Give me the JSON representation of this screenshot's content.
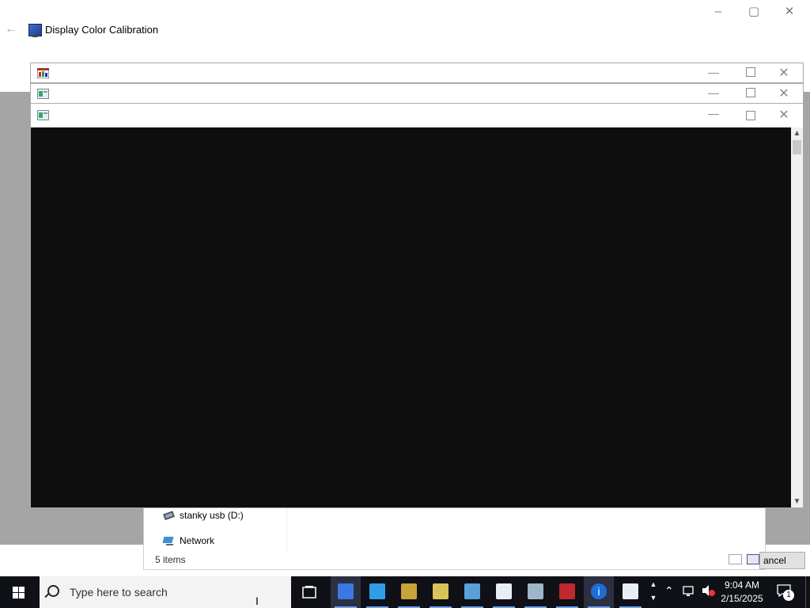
{
  "dcc": {
    "title": "Display Color Calibration",
    "back_icon": "back-arrow-icon",
    "controls": {
      "minimize": "–",
      "maximize": "▢",
      "close": "✕"
    }
  },
  "stack_windows": [
    {
      "icon": "image-app-icon"
    },
    {
      "icon": "window-app-icon"
    },
    {
      "icon": "window-app-icon"
    }
  ],
  "explorer": {
    "items": [
      {
        "label": "stanky usb (D:)",
        "icon": "usb-drive-icon"
      },
      {
        "label": "Network",
        "icon": "network-icon"
      }
    ],
    "status": "5 items"
  },
  "cancel_button": "ancel",
  "taskbar": {
    "search_placeholder": "Type here to search",
    "clock_time": "9:04 AM",
    "clock_date": "2/15/2025",
    "notification_count": "1",
    "apps": [
      {
        "name": "display-calibration-app",
        "color": "#3b78e7",
        "active": true
      },
      {
        "name": "windows-update-app",
        "color": "#2f9ee8",
        "active": false
      },
      {
        "name": "paint-app",
        "color": "#c8a23a",
        "active": false
      },
      {
        "name": "pencil-app",
        "color": "#d7c35a",
        "active": false
      },
      {
        "name": "window-app",
        "color": "#5aa0d8",
        "active": false
      },
      {
        "name": "notepad-app",
        "color": "#e8eef5",
        "active": false
      },
      {
        "name": "printer-app",
        "color": "#9fb6c8",
        "active": false
      },
      {
        "name": "toolbox-app",
        "color": "#c0282d",
        "active": false
      },
      {
        "name": "info-app",
        "color": "#1c6fd6",
        "active": true
      },
      {
        "name": "window-app-2",
        "color": "#e8eef5",
        "active": false
      }
    ]
  },
  "colors": {
    "gray_backdrop": "#a5a5a5",
    "canvas": "#0e0e0e",
    "taskbar": "#0f1117"
  }
}
